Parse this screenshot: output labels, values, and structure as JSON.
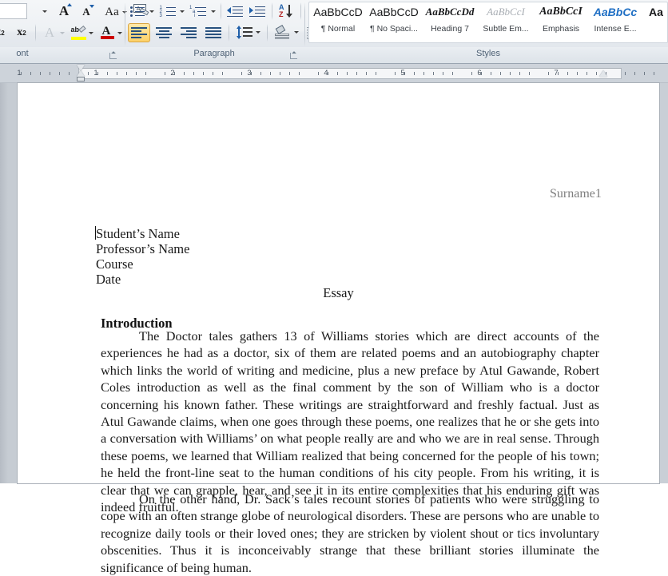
{
  "ribbon": {
    "groups": [
      {
        "label": "ont",
        "name": "font-group"
      },
      {
        "label": "Paragraph",
        "name": "paragraph-group"
      },
      {
        "label": "Styles",
        "name": "styles-group"
      }
    ],
    "font_group": {
      "grow_font": "A",
      "shrink_font": "A",
      "change_case": "Aa",
      "clear_formatting": "A",
      "subscript": "x",
      "subscript_sub": "2",
      "superscript": "x",
      "superscript_sup": "2",
      "text_effects": "A",
      "highlight_letters": "ab",
      "font_color": "A",
      "highlight_color": "#ffff00",
      "font_color_swatch": "#cc0000"
    },
    "paragraph_group": {
      "bullets": "bullets",
      "numbering": "numbering",
      "multilevel": "multilevel-list",
      "decrease_indent": "decrease-indent",
      "increase_indent": "increase-indent",
      "sort": "sort",
      "sort_a": "A",
      "sort_z": "Z",
      "show_marks": "¶",
      "align_left": "align-left",
      "align_center": "align-center",
      "align_right": "align-right",
      "justify": "justify",
      "line_spacing": "line-spacing",
      "shading": "shading",
      "borders": "borders",
      "active_alignment": "align-left"
    },
    "styles": [
      {
        "preview": "AaBbCcD",
        "label": "¶ Normal",
        "style": "normal"
      },
      {
        "preview": "AaBbCcD",
        "label": "¶ No Spaci...",
        "style": "normal"
      },
      {
        "preview": "AaBbCcDd",
        "label": "Heading 7",
        "style": "italic"
      },
      {
        "preview": "AaBbCcI",
        "label": "Subtle Em...",
        "style": "italic-gray"
      },
      {
        "preview": "AaBbCcI",
        "label": "Emphasis",
        "style": "bold-italic"
      },
      {
        "preview": "AaBbCc",
        "label": "Intense E...",
        "style": "blue-bold-italic"
      },
      {
        "preview": "Aa",
        "label": "",
        "style": "cut"
      }
    ]
  },
  "ruler": {
    "numbers": [
      "1",
      "1",
      "2",
      "3",
      "4",
      "5",
      "6",
      "7"
    ],
    "first_line_indent_marker": "first-line-indent",
    "hanging_indent_marker": "hanging-indent",
    "left_indent_marker": "left-indent",
    "right_indent_marker": "right-indent"
  },
  "document": {
    "header_text": "Surname1",
    "heading_block": [
      "Student’s Name",
      "Professor’s Name",
      "Course",
      "Date"
    ],
    "title": "Essay",
    "section_heading": "Introduction",
    "paragraphs": [
      "The Doctor tales gathers 13 of Williams stories which are direct accounts of the experiences he had as a doctor, six of them are related poems and an autobiography chapter which links the world of writing and medicine, plus a new preface by Atul Gawande, Robert Coles introduction as well as the final comment by the son of William who is a doctor concerning his known father. These writings are straightforward and freshly factual. Just as Atul Gawande claims, when one goes through these poems, one realizes that he or she gets into a conversation with Williams’ on what people really are and who we are in real sense. Through these poems, we learned that William realized that being concerned for the people of his town; he held the front-line seat to the human conditions of his city people. From his writing, it is clear that we can grapple, hear, and see it in its entire complexities that his enduring gift was indeed fruitful.",
      "On the other hand, Dr. Sack’s tales recount stories of patients who were struggling to cope with an often strange globe of neurological disorders. These are persons who are unable to recognize daily tools or their loved ones; they are stricken by violent shout or tics involuntary obscenities. Thus it is inconceivably strange that these brilliant stories illuminate the significance of being human."
    ]
  }
}
